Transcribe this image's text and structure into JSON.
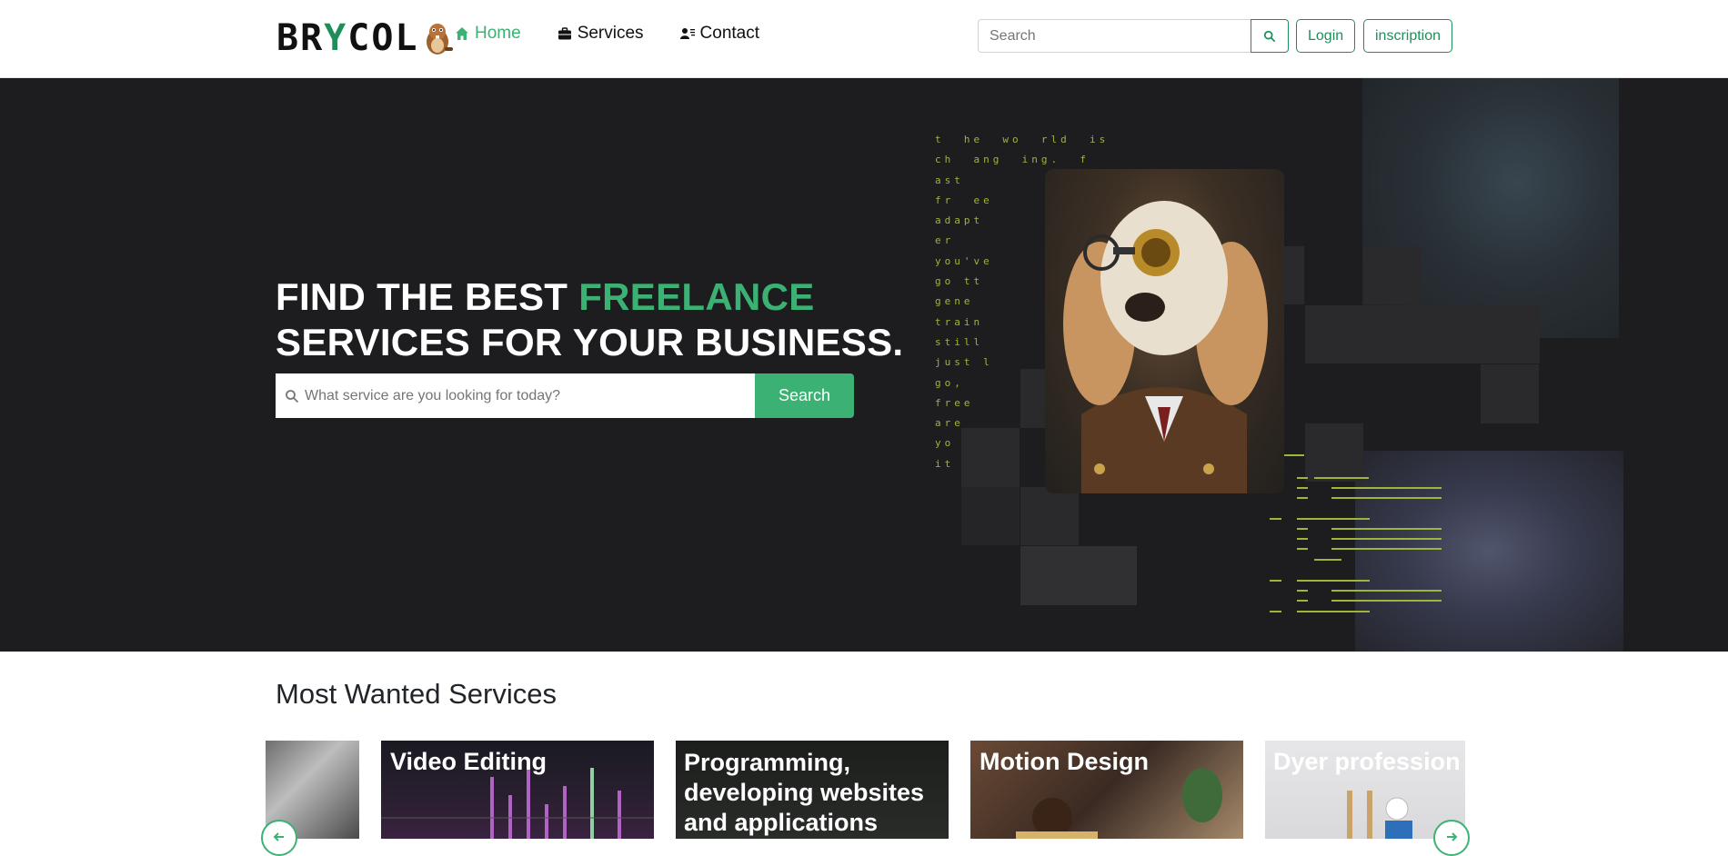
{
  "brand": {
    "logo_text_a": "BR",
    "logo_text_y": "Y",
    "logo_text_b": "COL"
  },
  "nav": {
    "home": "Home",
    "services": "Services",
    "contact": "Contact"
  },
  "search": {
    "placeholder": "Search"
  },
  "auth": {
    "login": "Login",
    "register": "inscription"
  },
  "hero": {
    "title_line1_a": "FIND THE BEST ",
    "title_line1_accent": "FREELANCE",
    "title_line2": "SERVICES FOR YOUR BUSINESS.",
    "search_placeholder": "What service are you looking for today?",
    "search_button": "Search",
    "matrix_text": "t  he  wo  rld  is\nch  ang  ing.  f\nast\nfr  ee\nadapt\ner\nyou've\ngo tt\ngene\ntrain\nstill\njust l\ngo,\nfree\nare\nyo  n\nit  l"
  },
  "section": {
    "title": "Most Wanted Services"
  },
  "services": [
    {
      "title": ""
    },
    {
      "title": "Video Editing"
    },
    {
      "title": "Programming, developing websites and applications"
    },
    {
      "title": "Motion Design"
    },
    {
      "title": "Dyer profession"
    }
  ],
  "colors": {
    "accent": "#3bb273",
    "brand_dark": "#1f8f5a",
    "hero_bg": "#1d1d1f"
  }
}
